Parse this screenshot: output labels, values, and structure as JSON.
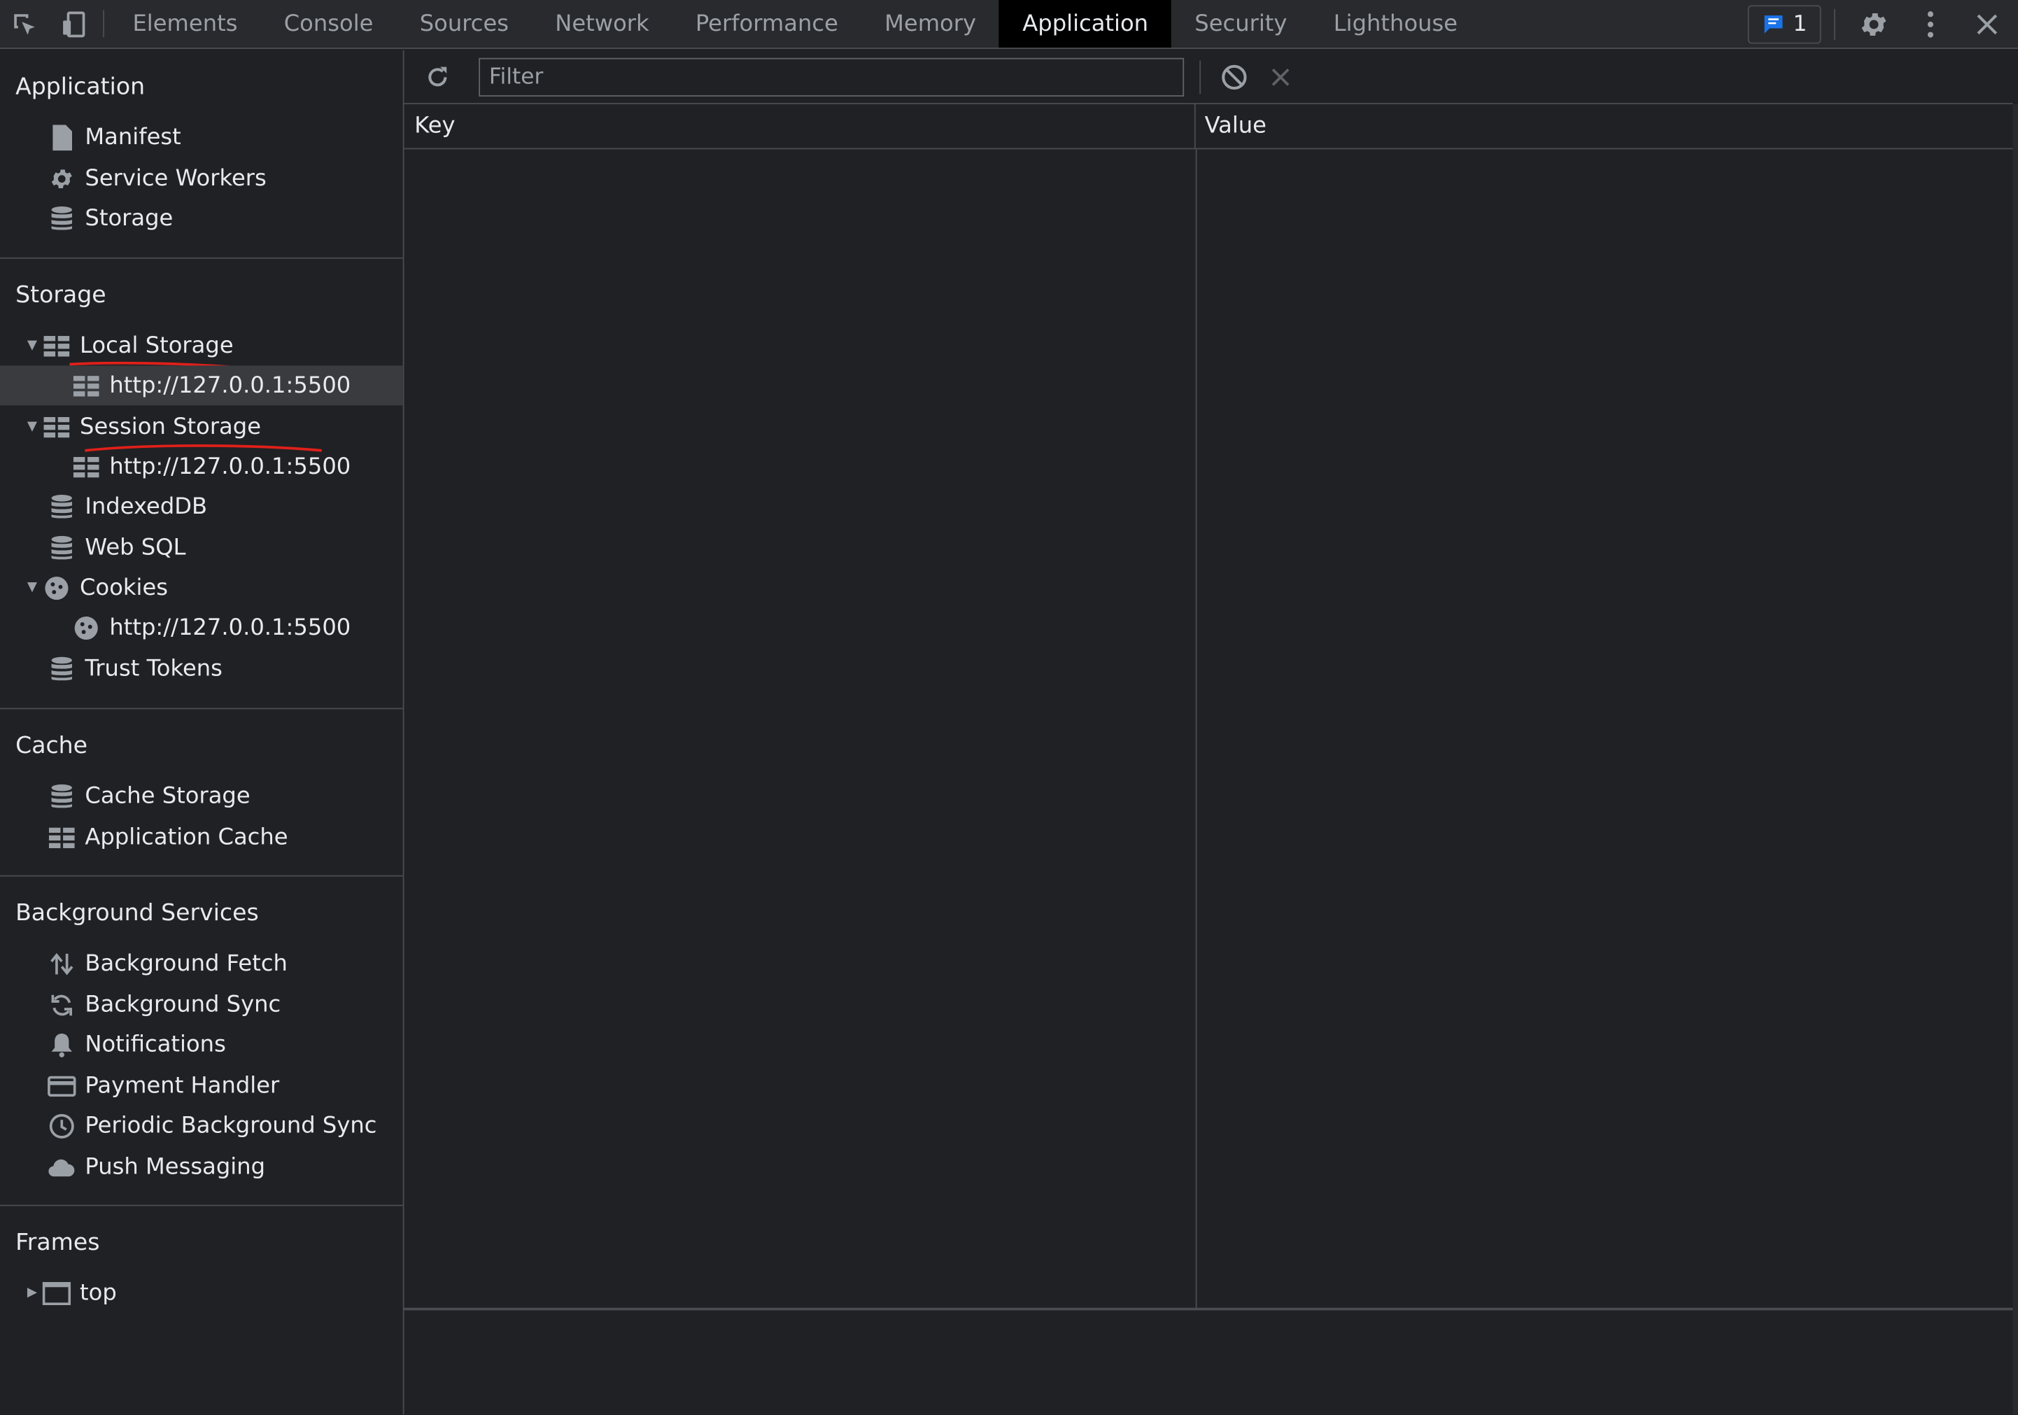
{
  "topbar": {
    "tabs": [
      "Elements",
      "Console",
      "Sources",
      "Network",
      "Performance",
      "Memory",
      "Application",
      "Security",
      "Lighthouse"
    ],
    "active_tab": "Application",
    "issues_count": "1"
  },
  "sidebar": {
    "application": {
      "title": "Application",
      "items": [
        "Manifest",
        "Service Workers",
        "Storage"
      ]
    },
    "storage": {
      "title": "Storage",
      "local_storage": "Local Storage",
      "local_origin": "http://127.0.0.1:5500",
      "session_storage": "Session Storage",
      "session_origin": "http://127.0.0.1:5500",
      "indexeddb": "IndexedDB",
      "websql": "Web SQL",
      "cookies": "Cookies",
      "cookies_origin": "http://127.0.0.1:5500",
      "trust_tokens": "Trust Tokens"
    },
    "cache": {
      "title": "Cache",
      "items": [
        "Cache Storage",
        "Application Cache"
      ]
    },
    "background": {
      "title": "Background Services",
      "items": [
        "Background Fetch",
        "Background Sync",
        "Notifications",
        "Payment Handler",
        "Periodic Background Sync",
        "Push Messaging"
      ]
    },
    "frames": {
      "title": "Frames",
      "top": "top"
    }
  },
  "main": {
    "filter_placeholder": "Filter",
    "columns": {
      "key": "Key",
      "value": "Value"
    }
  }
}
